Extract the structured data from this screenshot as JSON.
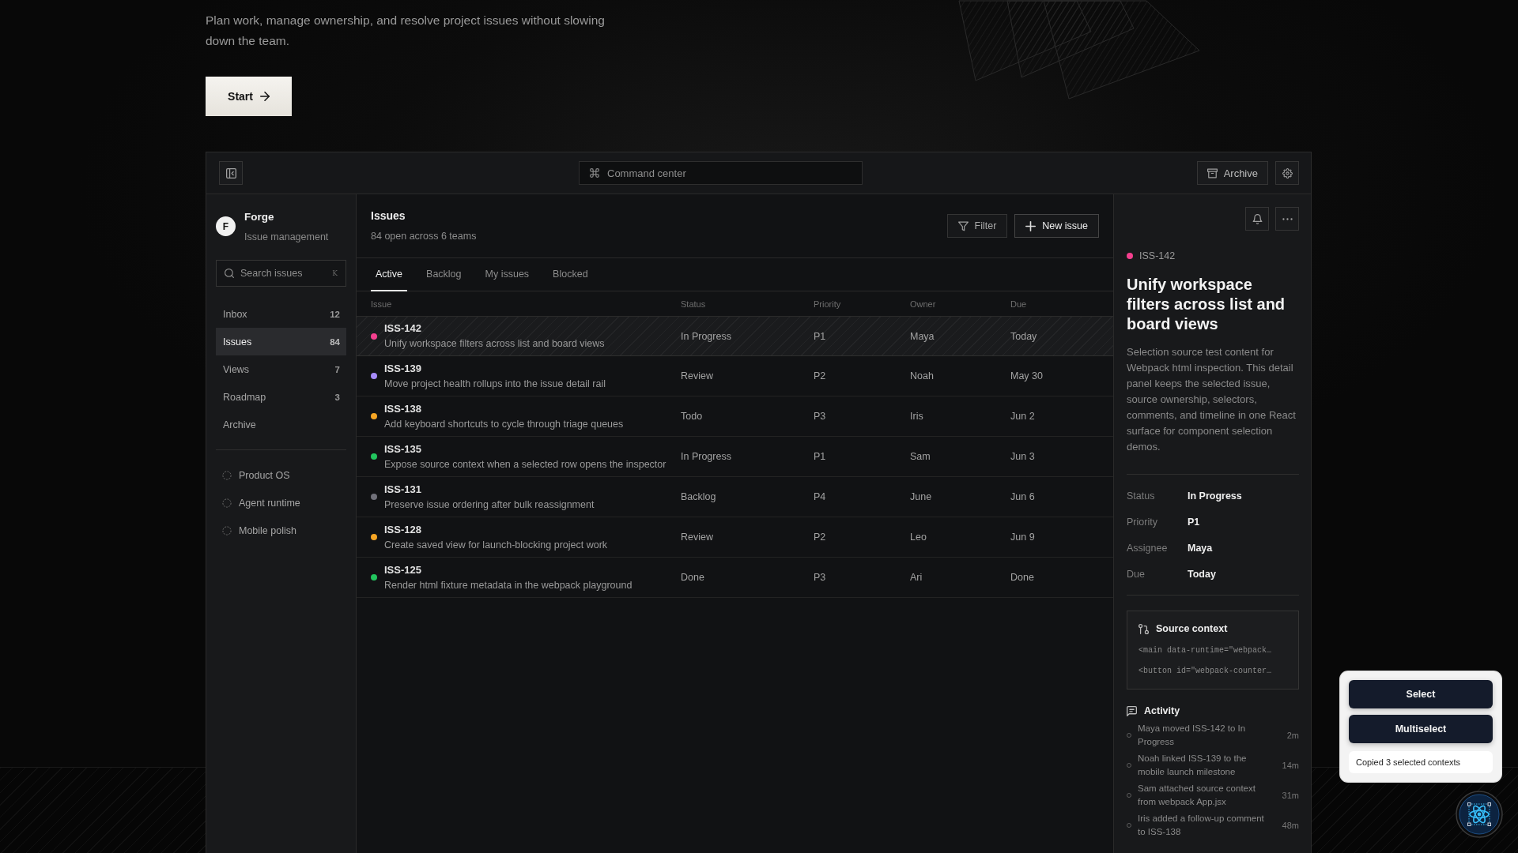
{
  "hero": {
    "description": "Plan work, manage ownership, and resolve project issues without slowing down the team.",
    "start_button": "Start"
  },
  "toolbar": {
    "command_center": {
      "placeholder": "Command center"
    },
    "archive_button": "Archive"
  },
  "sidebar": {
    "workspace": {
      "initial": "F",
      "name": "Forge",
      "subtitle": "Issue management"
    },
    "search": {
      "placeholder": "Search issues",
      "shortcut": "K"
    },
    "nav": [
      {
        "label": "Inbox",
        "count": "12",
        "selected": false
      },
      {
        "label": "Issues",
        "count": "84",
        "selected": true
      },
      {
        "label": "Views",
        "count": "7",
        "selected": false
      },
      {
        "label": "Roadmap",
        "count": "3",
        "selected": false
      },
      {
        "label": "Archive",
        "selected": false
      }
    ],
    "projects": [
      "Product OS",
      "Agent runtime",
      "Mobile polish"
    ]
  },
  "issues": {
    "title": "Issues",
    "subtitle": "84 open across 6 teams",
    "actions": [
      {
        "kind": "filter",
        "label": "Filter"
      },
      {
        "kind": "create",
        "label": "New issue"
      }
    ],
    "tabs": [
      {
        "label": "Active",
        "selected": true
      },
      {
        "label": "Backlog",
        "selected": false
      },
      {
        "label": "My issues",
        "selected": false
      },
      {
        "label": "Blocked",
        "selected": false
      }
    ],
    "table": {
      "columns": [
        "Issue",
        "Status",
        "Priority",
        "Owner",
        "Due"
      ],
      "rows": [
        {
          "id": "ISS-142",
          "title": "Unify workspace filters across list and board views",
          "status": "In Progress",
          "priority": "P1",
          "owner": "Maya",
          "due": "Today",
          "color": "#f43f8e",
          "selected": true
        },
        {
          "id": "ISS-139",
          "title": "Move project health rollups into the issue detail rail",
          "status": "Review",
          "priority": "P2",
          "owner": "Noah",
          "due": "May 30",
          "color": "#a78bfa",
          "selected": false
        },
        {
          "id": "ISS-138",
          "title": "Add keyboard shortcuts to cycle through triage queues",
          "status": "Todo",
          "priority": "P3",
          "owner": "Iris",
          "due": "Jun 2",
          "color": "#f5a524",
          "selected": false
        },
        {
          "id": "ISS-135",
          "title": "Expose source context when a selected row opens the inspector",
          "status": "In Progress",
          "priority": "P1",
          "owner": "Sam",
          "due": "Jun 3",
          "color": "#22c55e",
          "selected": false
        },
        {
          "id": "ISS-131",
          "title": "Preserve issue ordering after bulk reassignment",
          "status": "Backlog",
          "priority": "P4",
          "owner": "June",
          "due": "Jun 6",
          "color": "#71717a",
          "selected": false
        },
        {
          "id": "ISS-128",
          "title": "Create saved view for launch-blocking project work",
          "status": "Review",
          "priority": "P2",
          "owner": "Leo",
          "due": "Jun 9",
          "color": "#f5a524",
          "selected": false
        },
        {
          "id": "ISS-125",
          "title": "Render html fixture metadata in the webpack playground",
          "status": "Done",
          "priority": "P3",
          "owner": "Ari",
          "due": "Done",
          "color": "#22c55e",
          "selected": false
        }
      ]
    }
  },
  "detail": {
    "id": "ISS-142",
    "color": "#f43f8e",
    "title": "Unify workspace filters across list and board views",
    "description": "Selection source test content for Webpack html inspection. This detail panel keeps the selected issue, source ownership, selectors, comments, and timeline in one React surface for component selection demos.",
    "fields": [
      {
        "label": "Status",
        "value": "In Progress"
      },
      {
        "label": "Priority",
        "value": "P1"
      },
      {
        "label": "Assignee",
        "value": "Maya"
      },
      {
        "label": "Due",
        "value": "Today"
      }
    ],
    "source_context": {
      "title": "Source context",
      "lines": [
        "<main data-runtime=\"webpack…",
        "<button id=\"webpack-counter…"
      ]
    },
    "activity": {
      "title": "Activity",
      "items": [
        {
          "text": "Maya moved ISS-142 to In Progress",
          "time": "2m"
        },
        {
          "text": "Noah linked ISS-139 to the mobile launch milestone",
          "time": "14m"
        },
        {
          "text": "Sam attached source context from webpack App.jsx",
          "time": "31m"
        },
        {
          "text": "Iris added a follow-up comment to ISS-138",
          "time": "48m"
        }
      ]
    }
  },
  "inspector_popup": {
    "buttons": [
      "Select",
      "Multiselect"
    ],
    "message": "Copied 3 selected contexts"
  }
}
